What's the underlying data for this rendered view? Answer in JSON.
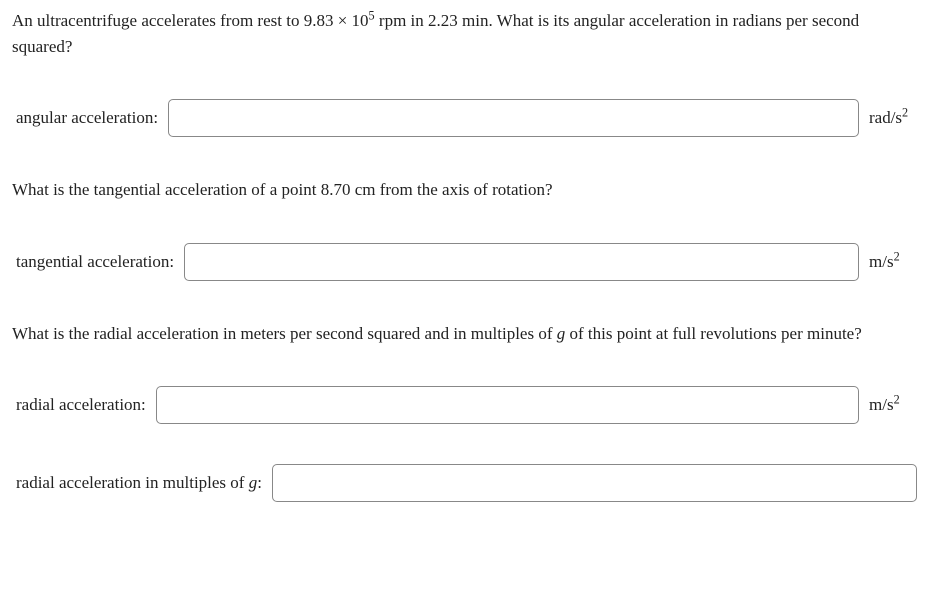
{
  "question1": {
    "prefix": "An ultracentrifuge accelerates from rest to 9.83 × 10",
    "exp": "5",
    "suffix": " rpm in 2.23 min. What is its angular acceleration in radians per second squared?"
  },
  "answer1": {
    "label": "angular acceleration:",
    "unit_prefix": "rad/s",
    "unit_exp": "2"
  },
  "question2": "What is the tangential acceleration of a point 8.70 cm from the axis of rotation?",
  "answer2": {
    "label": "tangential acceleration:",
    "unit_prefix": "m/s",
    "unit_exp": "2"
  },
  "question3": {
    "prefix": "What is the radial acceleration in meters per second squared and in multiples of ",
    "g": "g",
    "suffix": " of this point at full revolutions per minute?"
  },
  "answer3": {
    "label": "radial acceleration:",
    "unit_prefix": "m/s",
    "unit_exp": "2"
  },
  "answer4": {
    "label_prefix": "radial acceleration in multiples of ",
    "label_g": "g",
    "label_suffix": ":"
  }
}
